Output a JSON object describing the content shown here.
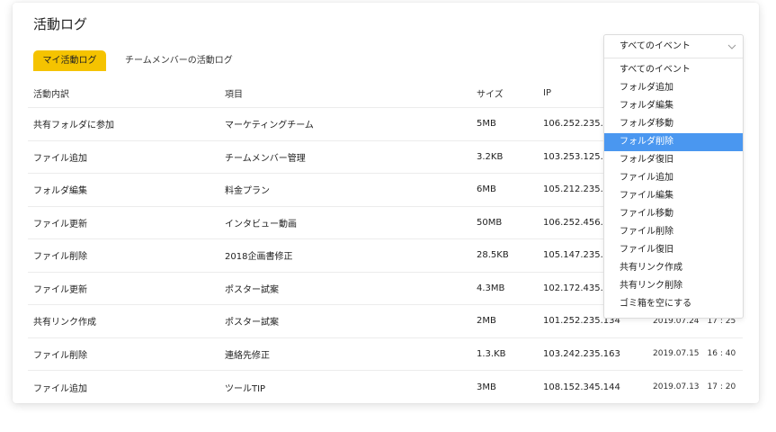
{
  "page": {
    "title": "活動ログ"
  },
  "tabs": [
    {
      "label": "マイ活動ログ",
      "active": true
    },
    {
      "label": "チームメンバーの活動ログ",
      "active": false
    }
  ],
  "table": {
    "headers": [
      "活動内訳",
      "項目",
      "サイズ",
      "IP"
    ],
    "rows": [
      {
        "action": "共有フォルダに参加",
        "item": "マーケティングチーム",
        "size": "5MB",
        "ip": "106.252.235.",
        "date": "",
        "time": ""
      },
      {
        "action": "ファイル追加",
        "item": "チームメンバー管理",
        "size": "3.2KB",
        "ip": "103.253.125.",
        "date": "",
        "time": ""
      },
      {
        "action": "フォルダ編集",
        "item": "料金プラン",
        "size": "6MB",
        "ip": "105.212.235.",
        "date": "",
        "time": ""
      },
      {
        "action": "ファイル更新",
        "item": "インタビュー動画",
        "size": "50MB",
        "ip": "106.252.456.",
        "date": "",
        "time": ""
      },
      {
        "action": "ファイル削除",
        "item": "2018企画書修正",
        "size": "28.5KB",
        "ip": "105.147.235.",
        "date": "",
        "time": ""
      },
      {
        "action": "ファイル更新",
        "item": "ポスター試案",
        "size": "4.3MB",
        "ip": "102.172.435.",
        "date": "",
        "time": ""
      },
      {
        "action": "共有リンク作成",
        "item": "ポスター試案",
        "size": "2MB",
        "ip": "101.252.235.134",
        "date": "2019.07.24",
        "time": "17 : 25"
      },
      {
        "action": "ファイル削除",
        "item": "連絡先修正",
        "size": "1.3.KB",
        "ip": "103.242.235.163",
        "date": "2019.07.15",
        "time": "16 : 40"
      },
      {
        "action": "ファイル追加",
        "item": "ツールTIP",
        "size": "3MB",
        "ip": "108.152.345.144",
        "date": "2019.07.13",
        "time": "17 : 20"
      }
    ]
  },
  "filter": {
    "selected": "すべてのイベント",
    "icon": "chevron-down-icon",
    "highlight_color": "#4a97f0",
    "options": [
      {
        "label": "すべてのイベント",
        "highlighted": false
      },
      {
        "label": "フォルダ追加",
        "highlighted": false
      },
      {
        "label": "フォルダ編集",
        "highlighted": false
      },
      {
        "label": "フォルダ移動",
        "highlighted": false
      },
      {
        "label": "フォルダ削除",
        "highlighted": true
      },
      {
        "label": "フォルダ復旧",
        "highlighted": false
      },
      {
        "label": "ファイル追加",
        "highlighted": false
      },
      {
        "label": "ファイル編集",
        "highlighted": false
      },
      {
        "label": "ファイル移動",
        "highlighted": false
      },
      {
        "label": "ファイル削除",
        "highlighted": false
      },
      {
        "label": "ファイル復旧",
        "highlighted": false
      },
      {
        "label": "共有リンク作成",
        "highlighted": false
      },
      {
        "label": "共有リンク削除",
        "highlighted": false
      },
      {
        "label": "ゴミ箱を空にする",
        "highlighted": false
      }
    ]
  },
  "colors": {
    "accent": "#f5c300",
    "highlight": "#4a97f0"
  }
}
